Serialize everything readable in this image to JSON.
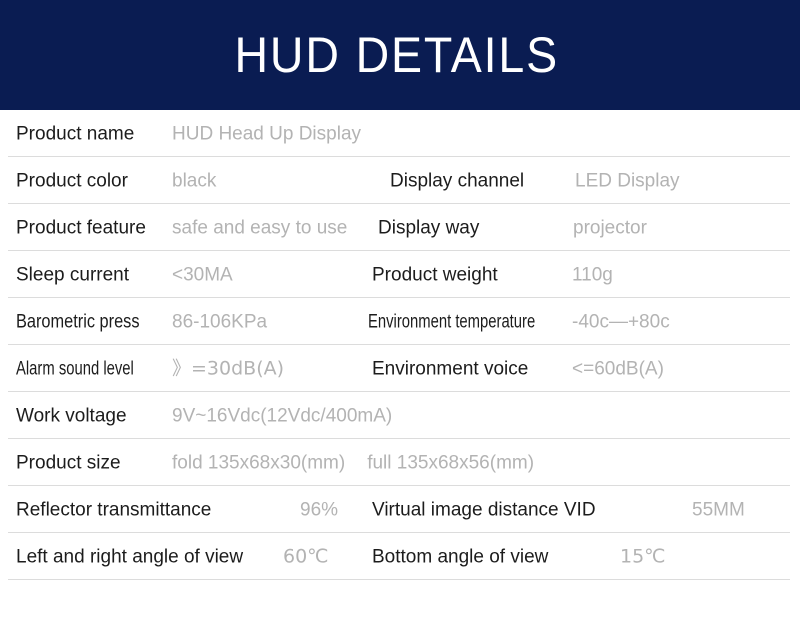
{
  "header": {
    "title": "HUD DETAILS",
    "background_color": "#0a1c52",
    "text_color": "#ffffff"
  },
  "theme": {
    "label_color": "#1c1c1c",
    "value_color": "#b3b3b3",
    "divider_color": "#dcdcdc",
    "page_background": "#ffffff"
  },
  "spec_table": {
    "rows": [
      {
        "left_label": "Product name",
        "left_value": "HUD Head Up Display",
        "right_label": "",
        "right_value": ""
      },
      {
        "left_label": "Product color",
        "left_value": "black",
        "right_label": "Display channel",
        "right_value": "LED Display"
      },
      {
        "left_label": "Product feature",
        "left_value": "safe and easy to use",
        "right_label": "Display way",
        "right_value": "projector"
      },
      {
        "left_label": "Sleep current",
        "left_value": "<30MA",
        "right_label": "Product weight",
        "right_value": "110g"
      },
      {
        "left_label": "Barometric press",
        "left_value": "86-106KPa",
        "right_label": "Environment temperature",
        "right_value": "-40c—+80c"
      },
      {
        "left_label": "Alarm sound level",
        "left_value": "》=30dB(A)",
        "right_label": "Environment voice",
        "right_value": "<=60dB(A)"
      },
      {
        "left_label": "Work voltage",
        "left_value": "9V~16Vdc(12Vdc/400mA)",
        "right_label": "",
        "right_value": ""
      },
      {
        "left_label": "Product size",
        "left_value_a": "fold  135x68x30(mm)",
        "left_value_b": "full 135x68x56(mm)",
        "right_label": "",
        "right_value": ""
      },
      {
        "left_label": "Reflector transmittance",
        "left_value": "96%",
        "right_label": "Virtual image distance VID",
        "right_value": "55MM"
      },
      {
        "left_label": "Left and right angle of view",
        "left_value": "60℃",
        "right_label": "Bottom angle of view",
        "right_value": "15℃"
      }
    ]
  }
}
